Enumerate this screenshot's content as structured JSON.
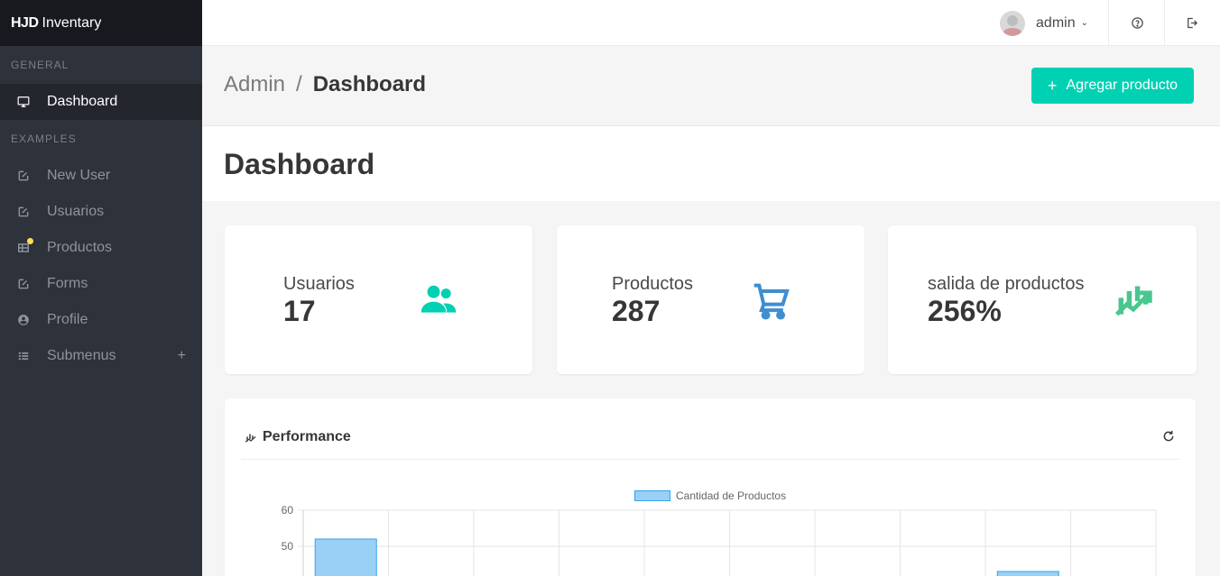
{
  "app": {
    "brand_bold": "HJD",
    "brand_rest": "Inventary"
  },
  "sidebar": {
    "sections": [
      {
        "label": "General"
      },
      {
        "label": "Examples"
      }
    ],
    "items": [
      {
        "label": "Dashboard",
        "icon": "desktop-icon",
        "active": true
      },
      {
        "label": "New User",
        "icon": "edit-icon"
      },
      {
        "label": "Usuarios",
        "icon": "edit-icon"
      },
      {
        "label": "Productos",
        "icon": "table-icon",
        "badge_color": "#ffdd57"
      },
      {
        "label": "Forms",
        "icon": "edit-icon"
      },
      {
        "label": "Profile",
        "icon": "account-circle-icon"
      },
      {
        "label": "Submenus",
        "icon": "list-icon",
        "expand_symbol": "+"
      }
    ]
  },
  "navbar": {
    "user_name": "admin",
    "help_icon": "help-circle-icon",
    "logout_icon": "logout-icon"
  },
  "breadcrumb": {
    "parent": "Admin",
    "separator": "/",
    "current": "Dashboard"
  },
  "actions": {
    "add_label": "Agregar producto",
    "add_symbol": "+"
  },
  "hero": {
    "title": "Dashboard"
  },
  "stats": [
    {
      "label": "Usuarios",
      "value": "17",
      "icon": "account-multiple-icon",
      "color": "#00d1b2"
    },
    {
      "label": "Productos",
      "value": "287",
      "icon": "cart-outline-icon",
      "color": "#3e8ed0"
    },
    {
      "label": "salida de productos",
      "value": "256%",
      "icon": "chart-timeline-variant-icon",
      "color": "#48c78e"
    }
  ],
  "performance": {
    "title": "Performance",
    "chart_data": {
      "type": "bar",
      "series": [
        {
          "name": "Cantidad de Productos",
          "values": [
            52,
            null,
            null,
            null,
            null,
            null,
            null,
            null,
            43,
            null
          ]
        }
      ],
      "ylim": [
        40,
        60
      ],
      "yticks": [
        "60",
        "50"
      ],
      "colors": {
        "fill": "#9ad0f5",
        "border": "#36a2eb"
      }
    }
  }
}
